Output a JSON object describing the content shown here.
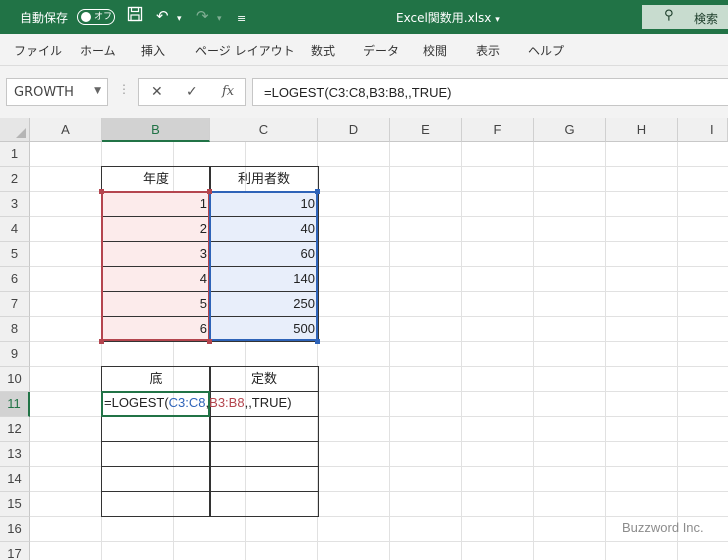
{
  "titlebar": {
    "autosave_label": "自動保存",
    "autosave_state": "オフ",
    "filename": "Excel関数用.xlsx",
    "filename_arrow": "▾",
    "search_label": "検索",
    "bg_color": "#217346"
  },
  "menu": {
    "items": [
      "ファイル",
      "ホーム",
      "挿入",
      "ページ レイアウト",
      "数式",
      "データ",
      "校閲",
      "表示",
      "ヘルプ"
    ]
  },
  "formulabar": {
    "name_box": "GROWTH",
    "cancel_glyph": "✕",
    "enter_glyph": "✓",
    "fx_glyph": "fx",
    "formula": "=LOGEST(C3:C8,B3:B8,,TRUE)"
  },
  "columns": [
    "A",
    "B",
    "C",
    "D",
    "E",
    "F",
    "G",
    "H",
    "I"
  ],
  "rows": [
    "1",
    "2",
    "3",
    "4",
    "5",
    "6",
    "7",
    "8",
    "9",
    "10",
    "11",
    "12",
    "13",
    "14",
    "15",
    "16",
    "17"
  ],
  "table1": {
    "header_year": "年度",
    "header_users": "利用者数",
    "years": [
      "1",
      "2",
      "3",
      "4",
      "5",
      "6"
    ],
    "users": [
      "10",
      "40",
      "60",
      "140",
      "250",
      "500"
    ]
  },
  "table2": {
    "header_base": "底",
    "header_const": "定数"
  },
  "cell_b11": {
    "prefix": "=LOGEST(",
    "ref1": "C3:C8",
    "sep1": ",",
    "ref2": "B3:B8",
    "suffix": ",,TRUE)"
  },
  "watermark": "Buzzword Inc.",
  "colors": {
    "accent": "#217346",
    "range_red": "#b4454e",
    "range_blue": "#2e63b8"
  }
}
